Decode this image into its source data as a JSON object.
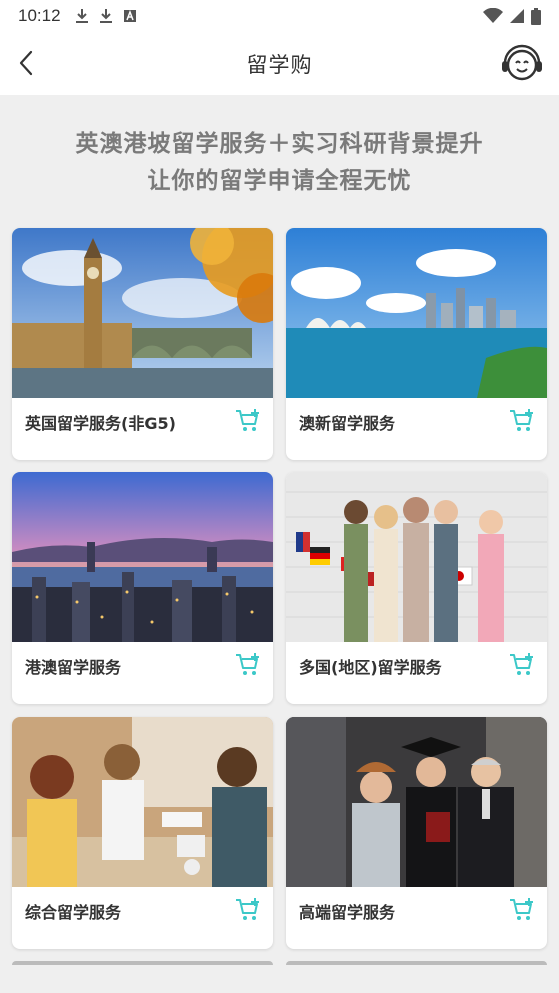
{
  "status_bar": {
    "time": "10:12",
    "left_icons": [
      "download-icon",
      "download-icon",
      "font-icon"
    ],
    "right_icons": [
      "wifi-icon",
      "signal-icon",
      "battery-icon"
    ]
  },
  "header": {
    "title": "留学购",
    "back_icon": "chevron-left-icon",
    "support_icon": "customer-service-icon"
  },
  "headline": {
    "line1": "英澳港坡留学服务＋实习科研背景提升",
    "line2": "让你的留学申请全程无忧"
  },
  "cards": [
    {
      "label": "英国留学服务(非G5)",
      "image": "london-big-ben-photo"
    },
    {
      "label": "澳新留学服务",
      "image": "sydney-harbour-photo"
    },
    {
      "label": "港澳留学服务",
      "image": "hong-kong-skyline-photo"
    },
    {
      "label": "多国(地区)留学服务",
      "image": "students-flags-photo"
    },
    {
      "label": "综合留学服务",
      "image": "students-studying-photo"
    },
    {
      "label": "高端留学服务",
      "image": "graduation-photo"
    }
  ],
  "colors": {
    "accent": "#3cc8c8",
    "background": "#efefef",
    "headline": "#7a7a7a"
  }
}
